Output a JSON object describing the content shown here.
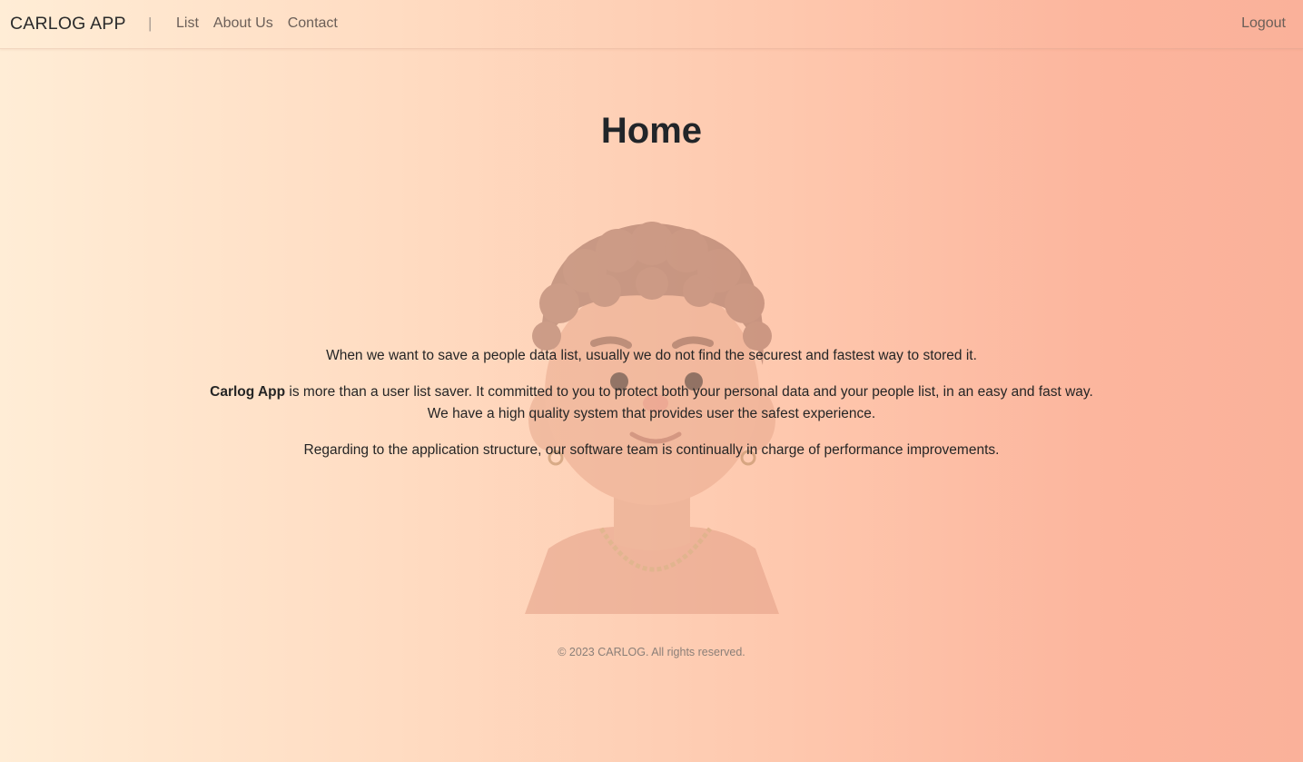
{
  "navbar": {
    "brand": "CARLOG APP",
    "separator": "|",
    "links": [
      {
        "label": "List"
      },
      {
        "label": "About Us"
      },
      {
        "label": "Contact"
      }
    ],
    "logout_label": "Logout"
  },
  "main": {
    "title": "Home",
    "paragraphs": {
      "p1": "When we want to save a people data list, usually we do not find the securest and fastest way to stored it.",
      "p2_strong": "Carlog App",
      "p2_rest": " is more than a user list saver. It committed to you to protect both your personal data and your people list, in an easy and fast way. We have a high quality system that provides user the safest experience.",
      "p3": "Regarding to the application structure, our software team is continually in charge of performance improvements."
    }
  },
  "footer": {
    "text": "© 2023 CARLOG. All rights reserved."
  },
  "colors": {
    "gradient_start": "#ffedd6",
    "gradient_end": "#fab19a",
    "text": "#212529"
  }
}
